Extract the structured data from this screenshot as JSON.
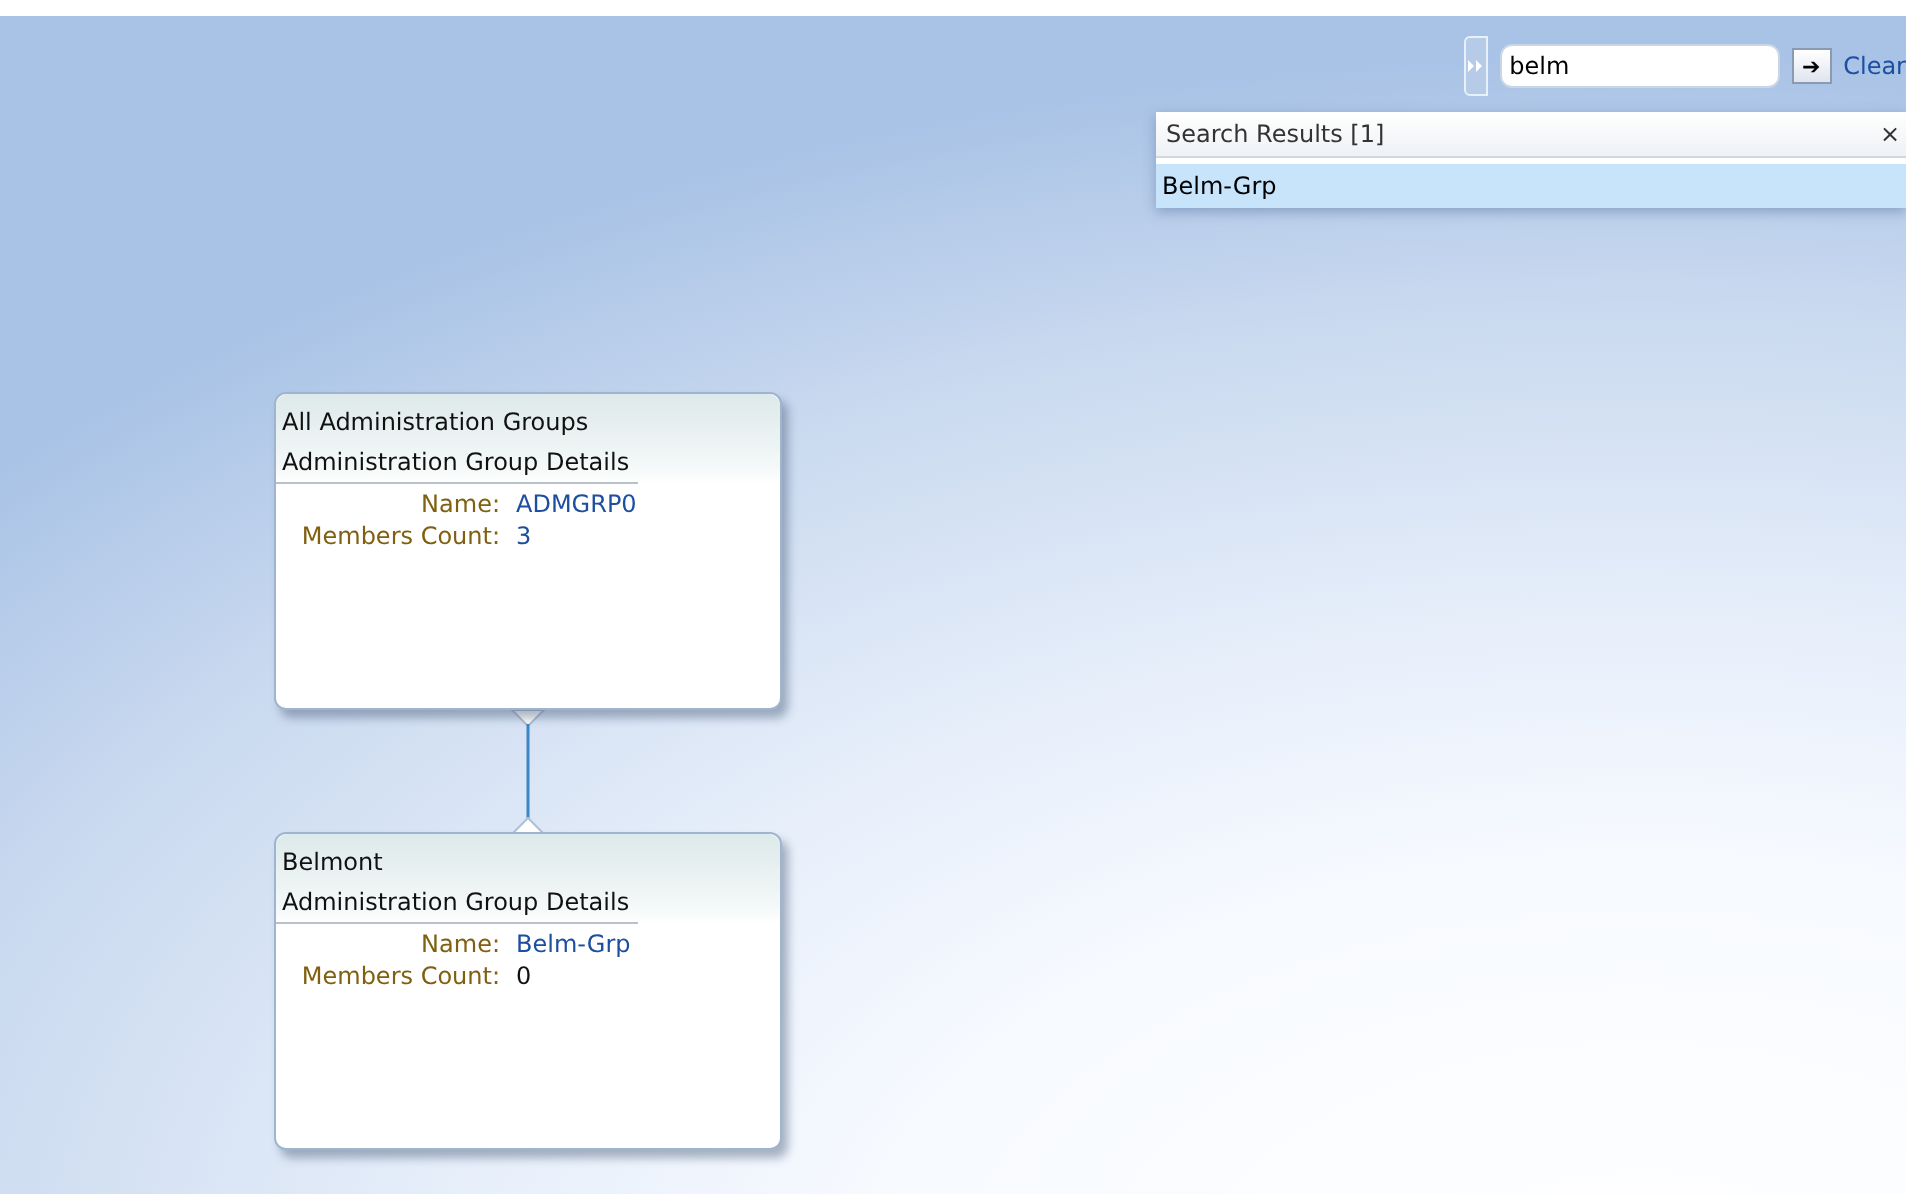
{
  "search": {
    "value": "belm",
    "go_button": "➔",
    "clear_link": "Clear"
  },
  "search_results": {
    "title": "Search Results [1]",
    "close": "×",
    "items": [
      {
        "label": "Belm-Grp",
        "selected": true
      }
    ]
  },
  "nodes": [
    {
      "title": "All Administration Groups",
      "section": "Administration Group Details",
      "fields": [
        {
          "label": "Name:",
          "value": "ADMGRP0",
          "link": true
        },
        {
          "label": "Members Count:",
          "value": "3",
          "link": true
        }
      ]
    },
    {
      "title": "Belmont",
      "section": "Administration Group Details",
      "fields": [
        {
          "label": "Name:",
          "value": "Belm-Grp",
          "link": true
        },
        {
          "label": "Members Count:",
          "value": "0",
          "link": false
        }
      ]
    }
  ]
}
